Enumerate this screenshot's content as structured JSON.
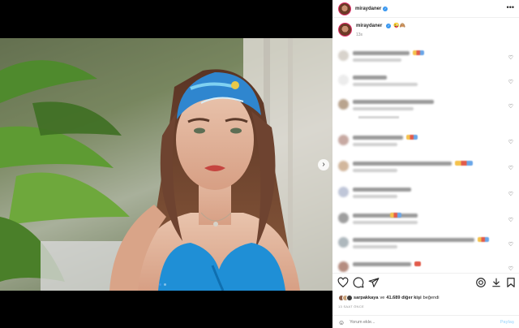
{
  "post": {
    "username": "miraydaner",
    "caption_emoji": "😜🙈",
    "caption_time": "13s",
    "likes": {
      "liker": "sarpakkaya",
      "connector": "ve",
      "others": "41.689 diğer kişi",
      "suffix": "beğendi"
    },
    "timestamp": "13 SAAT ÖNCE"
  },
  "comment_box": {
    "placeholder": "Yorum ekle...",
    "post_label": "Paylaş"
  },
  "icons": {
    "more": "more-options-icon",
    "next": "chevron-right-icon",
    "verified": "verified-badge-icon",
    "like": "heart-icon",
    "comment": "comment-icon",
    "share": "send-icon",
    "save": "bookmark-icon",
    "emoji": "emoji-icon"
  },
  "colors": {
    "accent": "#3897f0",
    "post_disabled": "#b2dffc",
    "muted": "#8e8e8e"
  },
  "carousel": {
    "slides": 2,
    "active": 1
  }
}
